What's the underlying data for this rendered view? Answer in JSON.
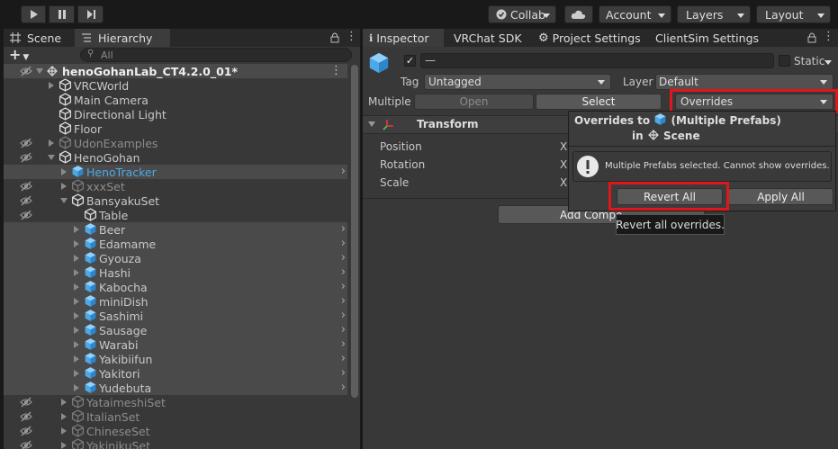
{
  "toolbar": {
    "play_icon": "play-icon",
    "pause_icon": "pause-icon",
    "step_icon": "step-icon",
    "collab_label": "Collab",
    "cloud_icon": "cloud-icon",
    "account_label": "Account",
    "layers_label": "Layers",
    "layout_label": "Layout"
  },
  "left_tabs": {
    "scene": "Scene",
    "hierarchy": "Hierarchy"
  },
  "hierarchy": {
    "add_label": "+",
    "search_placeholder": "All",
    "root": "henoGohanLab_CT4.2.0_01*",
    "items": [
      {
        "label": "VRCWorld"
      },
      {
        "label": "Main Camera"
      },
      {
        "label": "Directional Light"
      },
      {
        "label": "Floor"
      },
      {
        "label": "UdonExamples"
      },
      {
        "label": "HenoGohan"
      },
      {
        "label": "HenoTracker"
      },
      {
        "label": "xxxSet"
      },
      {
        "label": "BansyakuSet"
      },
      {
        "label": "Table"
      },
      {
        "label": "Beer"
      },
      {
        "label": "Edamame"
      },
      {
        "label": "Gyouza"
      },
      {
        "label": "Hashi"
      },
      {
        "label": "Kabocha"
      },
      {
        "label": "miniDish"
      },
      {
        "label": "Sashimi"
      },
      {
        "label": "Sausage"
      },
      {
        "label": "Warabi"
      },
      {
        "label": "Yakibiifun"
      },
      {
        "label": "Yakitori"
      },
      {
        "label": "Yudebuta"
      },
      {
        "label": "YataimeshiSet"
      },
      {
        "label": "ItalianSet"
      },
      {
        "label": "ChineseSet"
      },
      {
        "label": "YakinikuSet"
      }
    ]
  },
  "right_tabs": {
    "inspector": "Inspector",
    "vrchat_sdk": "VRChat SDK",
    "project_settings": "Project Settings",
    "clientsim": "ClientSim Settings"
  },
  "inspector": {
    "name_value": "—",
    "static_label": "Static",
    "tag_label": "Tag",
    "tag_value": "Untagged",
    "layer_label": "Layer",
    "layer_value": "Default",
    "multiple_label": "Multiple",
    "open_label": "Open",
    "select_label": "Select",
    "overrides_label": "Overrides",
    "transform_label": "Transform",
    "position_label": "Position",
    "rotation_label": "Rotation",
    "scale_label": "Scale",
    "x_label": "X",
    "add_component_label": "Add Compo"
  },
  "popup": {
    "title_prefix": "Overrides to",
    "title_suffix": "(Multiple Prefabs)",
    "in_label": "in",
    "scene_label": "Scene",
    "message": "Multiple Prefabs selected. Cannot show overrides.",
    "revert_all": "Revert All",
    "apply_all": "Apply All",
    "tooltip": "Revert all overrides."
  },
  "colors": {
    "highlight_red": "#e0161a",
    "prefab_blue": "#4fa8e6"
  }
}
